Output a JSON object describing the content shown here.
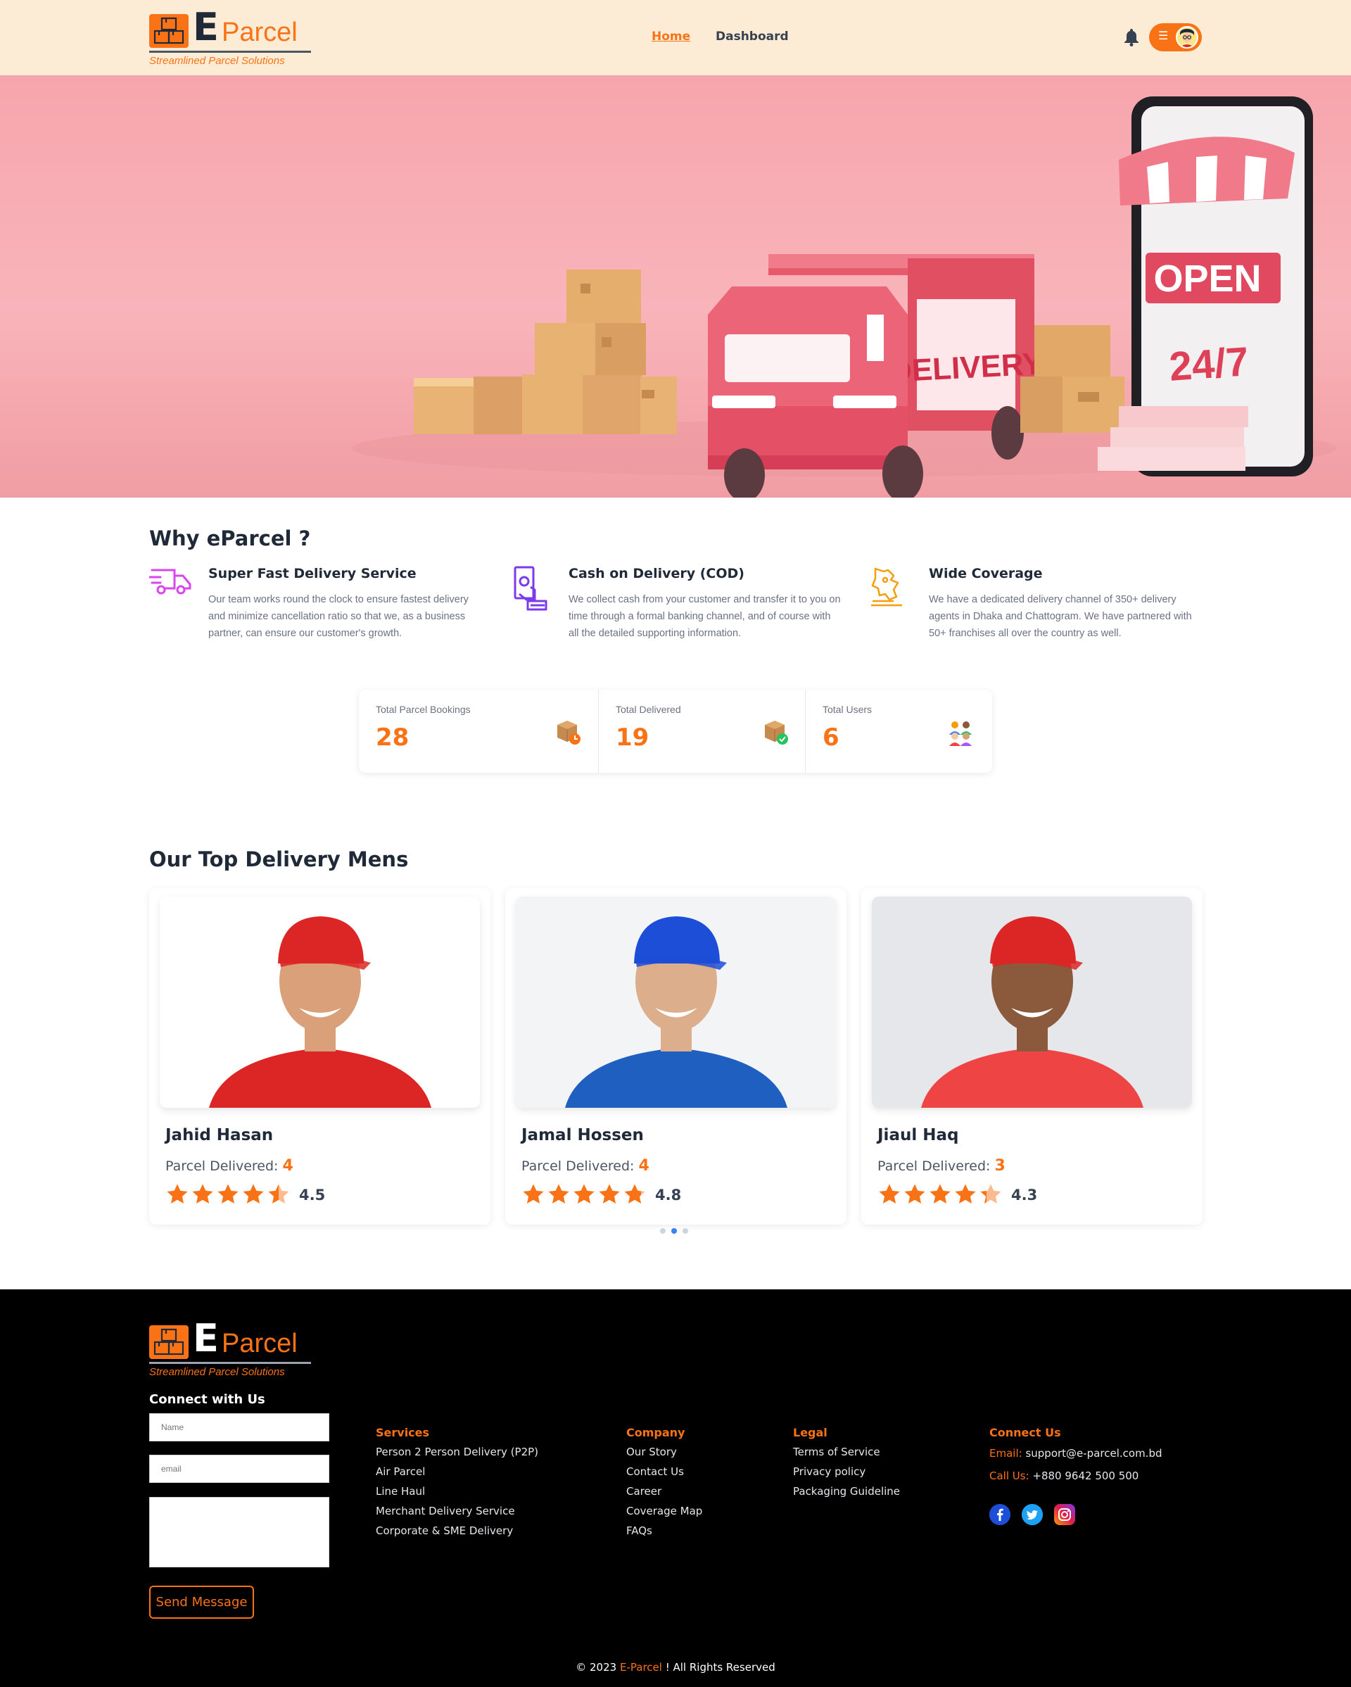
{
  "brand": {
    "letter": "E",
    "word": "Parcel",
    "tagline": "Streamlined Parcel Solutions"
  },
  "nav": {
    "home": "Home",
    "dashboard": "Dashboard"
  },
  "hero": {
    "delivery_text": "DELIVERY",
    "open_text": "OPEN",
    "hours_text": "24/7"
  },
  "why": {
    "title": "Why eParcel ?",
    "features": [
      {
        "title": "Super Fast Delivery Service",
        "desc": "Our team works round the clock to ensure fastest delivery and minimize cancellation ratio so that we, as a business partner, can ensure our customer's growth.",
        "icon": "fast-truck-icon",
        "color": "#d946ef"
      },
      {
        "title": "Cash on Delivery (COD)",
        "desc": "We collect cash from your customer and transfer it to you on time through a formal banking channel, and of course with all the detailed supporting information.",
        "icon": "cash-hand-icon",
        "color": "#7c3aed"
      },
      {
        "title": "Wide Coverage",
        "desc": "We have a dedicated delivery channel of 350+ delivery agents in Dhaka and Chattogram. We have partnered with 50+ franchises all over the country as well.",
        "icon": "map-coverage-icon",
        "color": "#f59e0b"
      }
    ]
  },
  "stats": [
    {
      "label": "Total Parcel Bookings",
      "value": "28",
      "icon": "parcel-clock-icon"
    },
    {
      "label": "Total Delivered",
      "value": "19",
      "icon": "parcel-check-icon"
    },
    {
      "label": "Total Users",
      "value": "6",
      "icon": "users-icon"
    }
  ],
  "top": {
    "title": "Our Top Delivery Mens",
    "delivered_label": "Parcel Delivered:",
    "men": [
      {
        "name": "Jahid Hasan",
        "delivered": "4",
        "rating": "4.5",
        "rating_value": 4.5,
        "cap": "#dc2626",
        "shirt": "#dc2626",
        "skin": "#d9a07a"
      },
      {
        "name": "Jamal Hossen",
        "delivered": "4",
        "rating": "4.8",
        "rating_value": 4.8,
        "cap": "#1d4ed8",
        "shirt": "#1e5fbf",
        "skin": "#dcae8c"
      },
      {
        "name": "Jiaul Haq",
        "delivered": "3",
        "rating": "4.3",
        "rating_value": 4.3,
        "cap": "#dc2626",
        "shirt": "#ef4444",
        "skin": "#8b5a3c"
      }
    ]
  },
  "footer": {
    "connect_title": "Connect with Us",
    "name_placeholder": "Name",
    "email_placeholder": "email",
    "send_label": "Send Message",
    "services": {
      "title": "Services",
      "items": [
        "Person 2 Person Delivery (P2P)",
        "Air Parcel",
        "Line Haul",
        "Merchant Delivery Service",
        "Corporate & SME Delivery"
      ]
    },
    "company": {
      "title": "Company",
      "items": [
        "Our Story",
        "Contact Us",
        "Career",
        "Coverage Map",
        "FAQs"
      ]
    },
    "legal": {
      "title": "Legal",
      "items": [
        "Terms of Service",
        "Privacy policy",
        "Packaging Guideline"
      ]
    },
    "contact": {
      "title": "Connect Us",
      "email_label": "Email:",
      "email": "support@e-parcel.com.bd",
      "call_label": "Call Us:",
      "phone": "+880 9642 500 500"
    },
    "copy_prefix": "© 2023",
    "copy_brand": "E-Parcel",
    "copy_suffix": "! All Rights Reserved"
  },
  "colors": {
    "accent": "#f97316",
    "nav_bg": "#fdecd5",
    "footer_bg": "#000000"
  }
}
